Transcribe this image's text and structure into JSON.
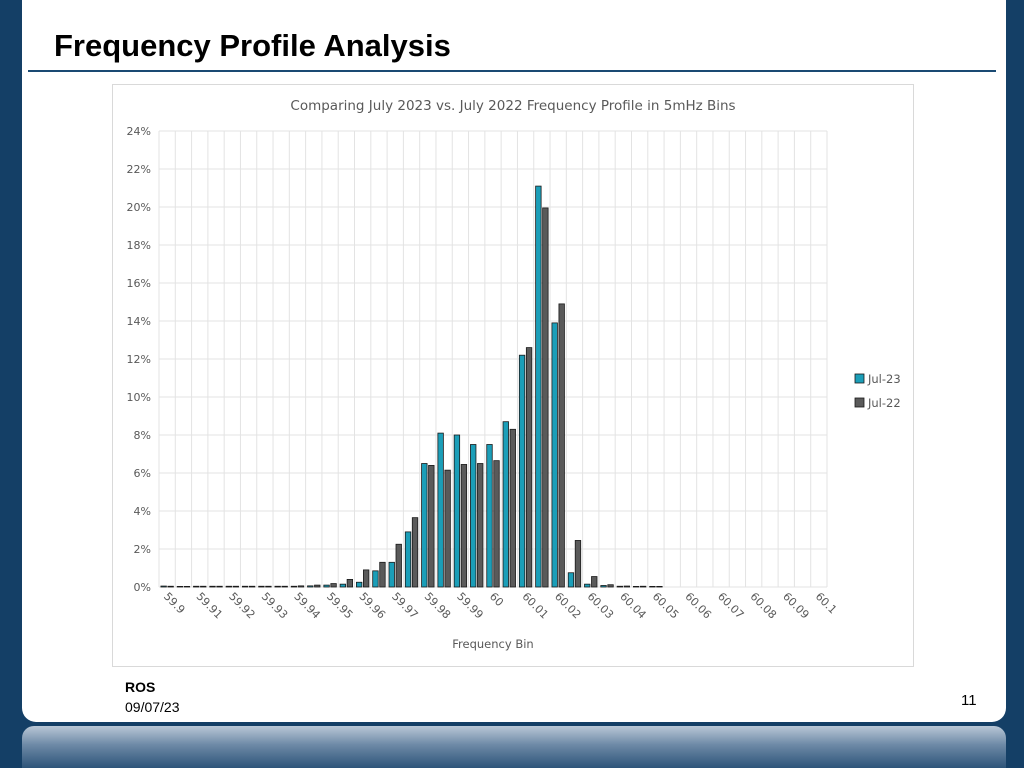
{
  "slide": {
    "title": "Frequency Profile Analysis",
    "footer_org": "ROS",
    "footer_date": "09/07/23",
    "page_number": "11"
  },
  "colors": {
    "jul23": "#1b9eb8",
    "jul22": "#5a5a5a",
    "bar_outline": "#1a1a1a",
    "grid": "#e3e3e3",
    "text": "#595959",
    "title_rule": "#1a4a73"
  },
  "chart_data": {
    "type": "bar",
    "title": "Comparing July 2023 vs. July 2022 Frequency Profile in 5mHz Bins",
    "xlabel": "Frequency Bin",
    "ylabel": "",
    "ylim": [
      0,
      0.24
    ],
    "y_ticks": [
      0,
      0.02,
      0.04,
      0.06,
      0.08,
      0.1,
      0.12,
      0.14,
      0.16,
      0.18,
      0.2,
      0.22,
      0.24
    ],
    "y_tick_labels": [
      "0%",
      "2%",
      "4%",
      "6%",
      "8%",
      "10%",
      "12%",
      "14%",
      "16%",
      "18%",
      "20%",
      "22%",
      "24%"
    ],
    "x_tick_labels": [
      "59.9",
      "59.91",
      "59.92",
      "59.93",
      "59.94",
      "59.95",
      "59.96",
      "59.97",
      "59.98",
      "59.99",
      "60",
      "60.01",
      "60.02",
      "60.03",
      "60.04",
      "60.05",
      "60.06",
      "60.07",
      "60.08",
      "60.09",
      "60.1"
    ],
    "categories": [
      "59.900",
      "59.905",
      "59.910",
      "59.915",
      "59.920",
      "59.925",
      "59.930",
      "59.935",
      "59.940",
      "59.945",
      "59.950",
      "59.955",
      "59.960",
      "59.965",
      "59.970",
      "59.975",
      "59.980",
      "59.985",
      "59.990",
      "59.995",
      "60.000",
      "60.005",
      "60.010",
      "60.015",
      "60.020",
      "60.025",
      "60.030",
      "60.035",
      "60.040",
      "60.045",
      "60.050",
      "60.055",
      "60.060",
      "60.065",
      "60.070",
      "60.075",
      "60.080",
      "60.085",
      "60.090",
      "60.095",
      "60.100"
    ],
    "grid": true,
    "legend_position": "right",
    "series": [
      {
        "name": "Jul-23",
        "values": [
          0.0005,
          0.0003,
          0.0004,
          0.0004,
          0.0004,
          0.0004,
          0.0004,
          0.0004,
          0.0004,
          0.0006,
          0.001,
          0.0015,
          0.0025,
          0.0085,
          0.013,
          0.029,
          0.065,
          0.081,
          0.08,
          0.075,
          0.075,
          0.087,
          0.122,
          0.211,
          0.139,
          0.0075,
          0.0015,
          0.0008,
          0.0004,
          0.0002,
          0.0001,
          0,
          0,
          0,
          0,
          0,
          0,
          0,
          0,
          0,
          0
        ]
      },
      {
        "name": "Jul-22",
        "values": [
          0.0004,
          0.0003,
          0.0004,
          0.0004,
          0.0004,
          0.0004,
          0.0004,
          0.0004,
          0.0006,
          0.001,
          0.0018,
          0.004,
          0.009,
          0.013,
          0.0225,
          0.0365,
          0.064,
          0.0615,
          0.0645,
          0.065,
          0.0665,
          0.083,
          0.126,
          0.1995,
          0.149,
          0.0245,
          0.0055,
          0.0012,
          0.0005,
          0.0004,
          0.0001,
          0,
          0,
          0,
          0,
          0,
          0,
          0,
          0,
          0,
          0
        ]
      }
    ]
  }
}
